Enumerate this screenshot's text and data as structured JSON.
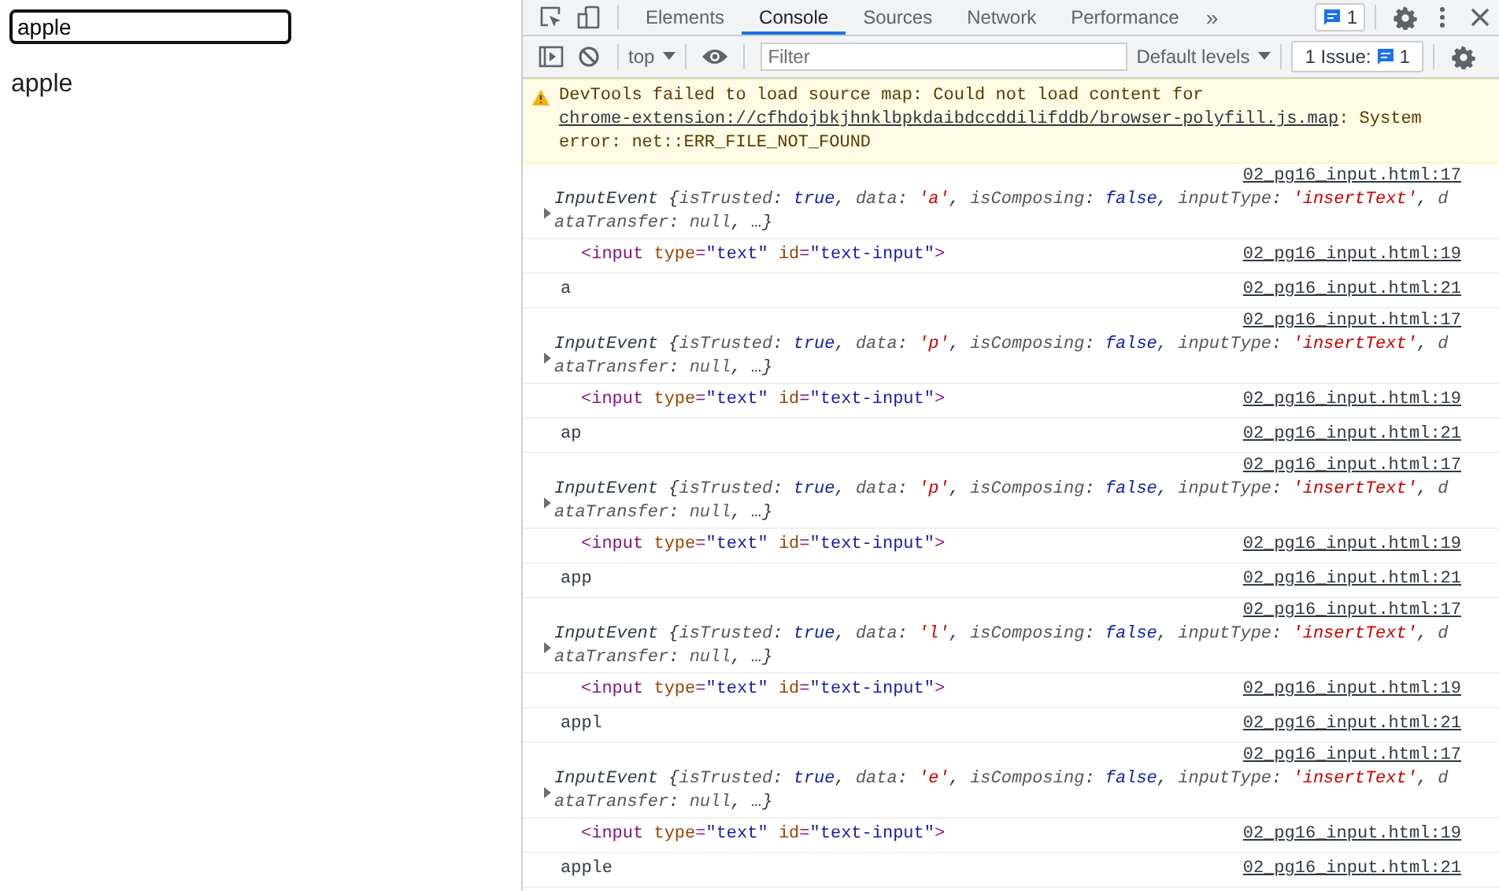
{
  "page": {
    "input": {
      "value": "apple",
      "focused": true
    },
    "output": "apple"
  },
  "devtools": {
    "tabs": [
      {
        "label": "Elements",
        "selected": false
      },
      {
        "label": "Console",
        "selected": true
      },
      {
        "label": "Sources",
        "selected": false
      },
      {
        "label": "Network",
        "selected": false
      },
      {
        "label": "Performance",
        "selected": false
      }
    ],
    "overflow": "»",
    "issues_badge": "1",
    "console_toolbar": {
      "context": "top",
      "filter": {
        "placeholder": "Filter"
      },
      "levels": "Default levels",
      "issues_label": "1 Issue:",
      "issues_count": "1"
    },
    "warning": {
      "text_before": "DevTools failed to load source map: Could not load content for ",
      "link": "chrome-extension://cfhdojbkjhnklbpkdaibdccddilifddb/browser-polyfill.js.map",
      "text_after": ": System error: net::ERR_FILE_NOT_FOUND"
    },
    "entries": [
      {
        "kind": "event",
        "source": "02_pg16_input.html:17",
        "expanded": false,
        "preview": "InputEvent {isTrusted: true, data: 'a', isComposing: false, inputType: 'insertText', dataTransfer: null, …}"
      },
      {
        "kind": "element",
        "source": "02_pg16_input.html:19",
        "node": "<input type=\"text\" id=\"text-input\">"
      },
      {
        "kind": "text",
        "source": "02_pg16_input.html:21",
        "text": "a"
      },
      {
        "kind": "event",
        "source": "02_pg16_input.html:17",
        "expanded": false,
        "preview": "InputEvent {isTrusted: true, data: 'p', isComposing: false, inputType: 'insertText', dataTransfer: null, …}"
      },
      {
        "kind": "element",
        "source": "02_pg16_input.html:19",
        "node": "<input type=\"text\" id=\"text-input\">"
      },
      {
        "kind": "text",
        "source": "02_pg16_input.html:21",
        "text": "ap"
      },
      {
        "kind": "event",
        "source": "02_pg16_input.html:17",
        "expanded": false,
        "preview": "InputEvent {isTrusted: true, data: 'p', isComposing: false, inputType: 'insertText', dataTransfer: null, …}"
      },
      {
        "kind": "element",
        "source": "02_pg16_input.html:19",
        "node": "<input type=\"text\" id=\"text-input\">"
      },
      {
        "kind": "text",
        "source": "02_pg16_input.html:21",
        "text": "app"
      },
      {
        "kind": "event",
        "source": "02_pg16_input.html:17",
        "expanded": false,
        "preview": "InputEvent {isTrusted: true, data: 'l', isComposing: false, inputType: 'insertText', dataTransfer: null, …}"
      },
      {
        "kind": "element",
        "source": "02_pg16_input.html:19",
        "node": "<input type=\"text\" id=\"text-input\">"
      },
      {
        "kind": "text",
        "source": "02_pg16_input.html:21",
        "text": "appl"
      },
      {
        "kind": "event",
        "source": "02_pg16_input.html:17",
        "expanded": false,
        "preview": "InputEvent {isTrusted: true, data: 'e', isComposing: false, inputType: 'insertText', dataTransfer: null, …}"
      },
      {
        "kind": "element",
        "source": "02_pg16_input.html:19",
        "node": "<input type=\"text\" id=\"text-input\">"
      },
      {
        "kind": "text",
        "source": "02_pg16_input.html:21",
        "text": "apple"
      }
    ]
  }
}
